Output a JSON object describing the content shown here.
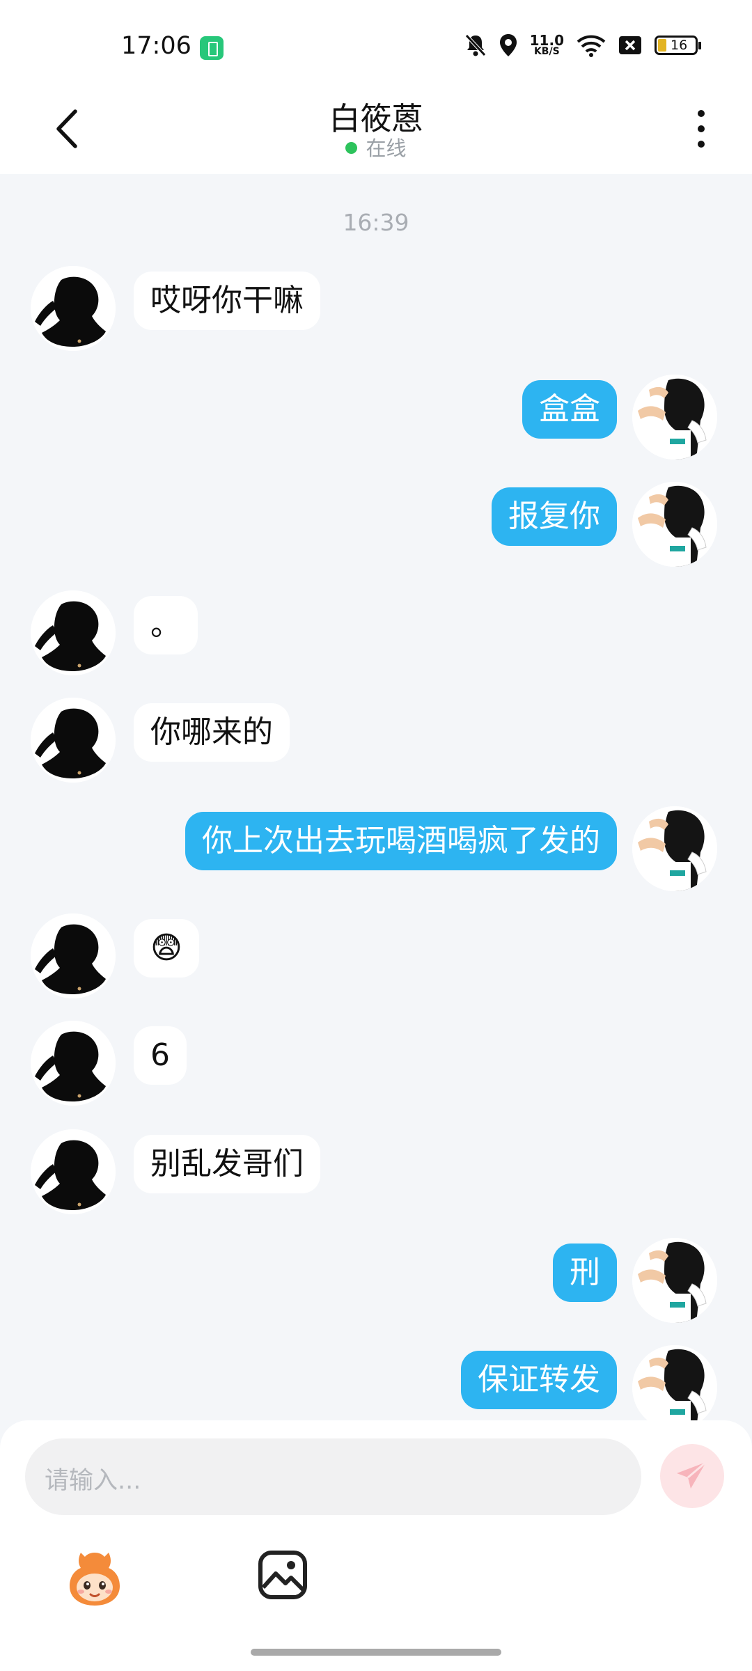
{
  "status_bar": {
    "time": "17:06",
    "net_speed_value": "11.0",
    "net_speed_unit": "KB/S",
    "battery": "16"
  },
  "header": {
    "contact_name": "白筱蒽",
    "presence": "在线"
  },
  "chat": {
    "timestamp": "16:39",
    "messages": [
      {
        "side": "in",
        "text": "哎呀你干嘛"
      },
      {
        "side": "out",
        "text": "盒盒"
      },
      {
        "side": "out",
        "text": "报复你"
      },
      {
        "side": "in",
        "text": "。"
      },
      {
        "side": "in",
        "text": "你哪来的"
      },
      {
        "side": "out",
        "text": "你上次出去玩喝酒喝疯了发的"
      },
      {
        "side": "in",
        "text": "😨"
      },
      {
        "side": "in",
        "text": "6"
      },
      {
        "side": "in",
        "text": "别乱发哥们"
      },
      {
        "side": "out",
        "text": "刑"
      },
      {
        "side": "out",
        "text": "保证转发"
      }
    ]
  },
  "composer": {
    "placeholder": "请输入..."
  },
  "colors": {
    "outgoing_bubble": "#2db4f1",
    "incoming_bubble": "#ffffff",
    "chat_background": "#f4f6f9",
    "online_dot": "#2dc35c",
    "send_button": "#fde4e6"
  },
  "icons": [
    "back-icon",
    "more-vertical-icon",
    "mute-bell-icon",
    "location-icon",
    "wifi-icon",
    "close-box-icon",
    "battery-icon",
    "send-icon",
    "emoji-mascot-icon",
    "image-icon"
  ]
}
